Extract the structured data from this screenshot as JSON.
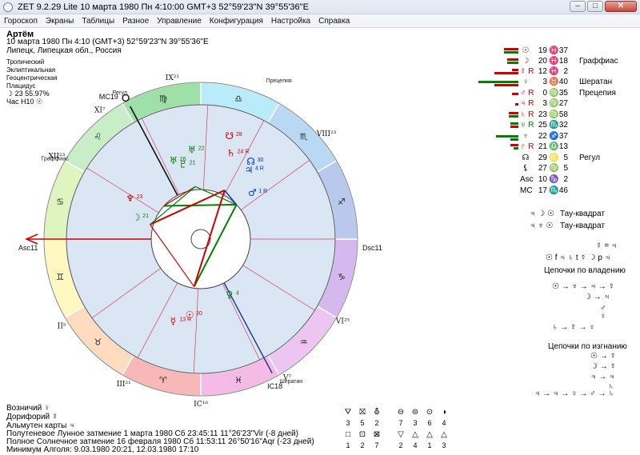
{
  "window": {
    "title": "ZET 9.2.29 Lite    10 марта 1980   Пн    4:10:00 GMT+3 52°59'23\"N  39°55'36\"E"
  },
  "menu": [
    "Гороскоп",
    "Экраны",
    "Таблицы",
    "Разное",
    "Управление",
    "Конфигурация",
    "Настройка",
    "Справка"
  ],
  "header": {
    "name": "Артём",
    "line1": "10 марта 1980   Пн    4:10 (GMT+3) 52°59'23\"N   39°55'36\"E",
    "line2": "Липецк, Липецкая обл., Россия",
    "settings": [
      "Тропический",
      "Эклиптикальная",
      "Геоцентрическая",
      "Плацидус"
    ],
    "moon_phase": "☽  23 55.97%",
    "hour_ruler": "Час H10  ☉"
  },
  "planets": [
    {
      "sym": "☉",
      "deg": "19",
      "sign": "♓",
      "min": "37",
      "name": "",
      "color": "#cc0000"
    },
    {
      "sym": "☽",
      "deg": "20",
      "sign": "♓",
      "min": "18",
      "name": "Граффиас",
      "color": "#cc0000"
    },
    {
      "sym": "☿ R",
      "deg": "12",
      "sign": "♓",
      "min": "2",
      "name": "",
      "color": "#cc0000"
    },
    {
      "sym": "♀",
      "deg": "3",
      "sign": "♉",
      "min": "40",
      "name": "Шератан",
      "color": "#008000"
    },
    {
      "sym": "♂ R",
      "deg": "0",
      "sign": "♍",
      "min": "35",
      "name": "Прецепия",
      "color": "#cc0000"
    },
    {
      "sym": "♃ R",
      "deg": "3",
      "sign": "♍",
      "min": "27",
      "name": "",
      "color": "#cc0000"
    },
    {
      "sym": "♄ R",
      "deg": "23",
      "sign": "♍",
      "min": "58",
      "name": "",
      "color": "#cc0000"
    },
    {
      "sym": "♅ R",
      "deg": "25",
      "sign": "♏",
      "min": "32",
      "name": "",
      "color": "#008000"
    },
    {
      "sym": "♆",
      "deg": "22",
      "sign": "♐",
      "min": "37",
      "name": "",
      "color": "#008000"
    },
    {
      "sym": "♇ R",
      "deg": "21",
      "sign": "♎",
      "min": "13",
      "name": "",
      "color": "#cc0000"
    },
    {
      "sym": "☊",
      "deg": "29",
      "sign": "♌",
      "min": "5",
      "name": "Регул",
      "color": "#000"
    },
    {
      "sym": "⚸",
      "deg": "27",
      "sign": "♍",
      "min": "5",
      "name": "",
      "color": "#000"
    },
    {
      "sym": "Asc",
      "deg": "10",
      "sign": "♑",
      "min": "2",
      "name": "",
      "color": "#000"
    },
    {
      "sym": "MC",
      "deg": "17",
      "sign": "♏",
      "min": "46",
      "name": "",
      "color": "#000"
    }
  ],
  "aspects": [
    {
      "syms": "♃ ☽ ☉",
      "label": "Тау-квадрат"
    },
    {
      "syms": "♃ ♆ ☉",
      "label": "Тау-квадрат"
    }
  ],
  "rulership": {
    "exchange": "☿ = ♃",
    "line": "☉ f ♃  ♄ t ☿  ☽ p ♃",
    "title": "Цепочки по владению",
    "chain1": "☉ → ♆ → ♃ → ☿",
    "chain2": "☽ → ♃",
    "chain3": "♂",
    "chain4": "♀",
    "chain5": "♄ → ☿ → ♀"
  },
  "exile": {
    "title": "Цепочки по изгнанию",
    "chain1": "☉ → ☿",
    "chain2": "☽ → ☿",
    "chain3": "♃ → ♃",
    "chain4": "♄",
    "chain5": "♃ → ♃ → ♀ → ♂ → ♄"
  },
  "bottom": {
    "l1": "Возничий  ♀",
    "l2": "Дорифорий  ☿",
    "l3": "Альмутен карты  ♃",
    "l4": "Полутеневое Лунное затмение 1 марта 1980 Сб 23:45:11 11°26'23\"Vir (-8 дней)",
    "l5": "Полное Солнечное затмение 16 февраля 1980 Сб 11:53:11 26°50'16\"Aqr (-23 дней)",
    "l6": "Минимум Алголя: 9.03.1980 20:21,  12.03.1980 17:10"
  },
  "tools": {
    "row1": [
      "⛛",
      "⛝",
      "⛢",
      "⊖",
      "⊜",
      "⊙",
      "◑"
    ],
    "row1n": [
      "3",
      "5",
      "2",
      "7",
      "3",
      "6",
      "4"
    ],
    "row2": [
      "□",
      "⊡",
      "⊠",
      "▽",
      "△",
      "△",
      "△"
    ],
    "row2n": [
      "1",
      "2",
      "7",
      "2",
      "4",
      "1",
      "3"
    ]
  },
  "chart": {
    "houses": [
      "IX",
      "VIII",
      "VII",
      "VI",
      "V",
      "IV",
      "III",
      "II",
      "I",
      "XII",
      "XI",
      "X"
    ],
    "house_labels": [
      {
        "t": "IX²¹"
      },
      {
        "t": "VIII²³"
      },
      {
        "t": "DSC"
      },
      {
        "t": "VI²⁵"
      },
      {
        "t": "V⁷"
      },
      {
        "t": "IC¹⁸"
      },
      {
        "t": "III²¹"
      },
      {
        "t": "II⁵"
      },
      {
        "t": "Asc¹¹"
      },
      {
        "t": "XII²³"
      },
      {
        "t": "XI⁷"
      },
      {
        "t": "MC¹⁹"
      }
    ],
    "mc_label": "MC",
    "mc_deg": "19",
    "asc_label": "Asc",
    "asc_deg": "11",
    "dsc_label": "Dsc",
    "dsc_deg": "11",
    "ic_label": "IC",
    "ic_deg": "18",
    "star_labels": [
      "Прецепия",
      "Регул",
      "Граффиас",
      "Шератан"
    ],
    "signs": [
      "♎",
      "♍",
      "♌",
      "♋",
      "♊",
      "♉",
      "♈",
      "♓",
      "♒",
      "♑",
      "♐",
      "♏"
    ],
    "sign_colors": [
      "#b9ecf8",
      "#9fdfa8",
      "#c8eec8",
      "#dff5c0",
      "#fff8c0",
      "#ffdcc0",
      "#f8b8b8",
      "#f4bbe6",
      "#ecc6f0",
      "#d4b8ee",
      "#b9c9ee",
      "#b9d8f4"
    ],
    "inner_planets": [
      {
        "g": "☉",
        "d": "20",
        "color": "#cc0000"
      },
      {
        "g": "☿",
        "d": "13 R",
        "color": "#cc0000"
      },
      {
        "g": "♀",
        "d": "4",
        "color": "#008000"
      },
      {
        "g": "♂",
        "d": "1 R",
        "color": "#0033cc"
      },
      {
        "g": "♃",
        "d": "4 R",
        "color": "#0033cc"
      },
      {
        "g": "☊",
        "d": "30",
        "color": "#0033cc"
      },
      {
        "g": "♄",
        "d": "24 R",
        "color": "#cc0000"
      },
      {
        "g": "☋",
        "d": "28",
        "color": "#cc0000"
      },
      {
        "g": "♅",
        "d": "22",
        "color": "#008000"
      },
      {
        "g": "♇",
        "d": "21",
        "color": "#008000"
      },
      {
        "g": "♅",
        "d": "26",
        "color": "#008000"
      },
      {
        "g": "♆",
        "d": "23",
        "color": "#cc0000"
      },
      {
        "g": "☽",
        "d": "21",
        "color": "#008000"
      }
    ]
  }
}
